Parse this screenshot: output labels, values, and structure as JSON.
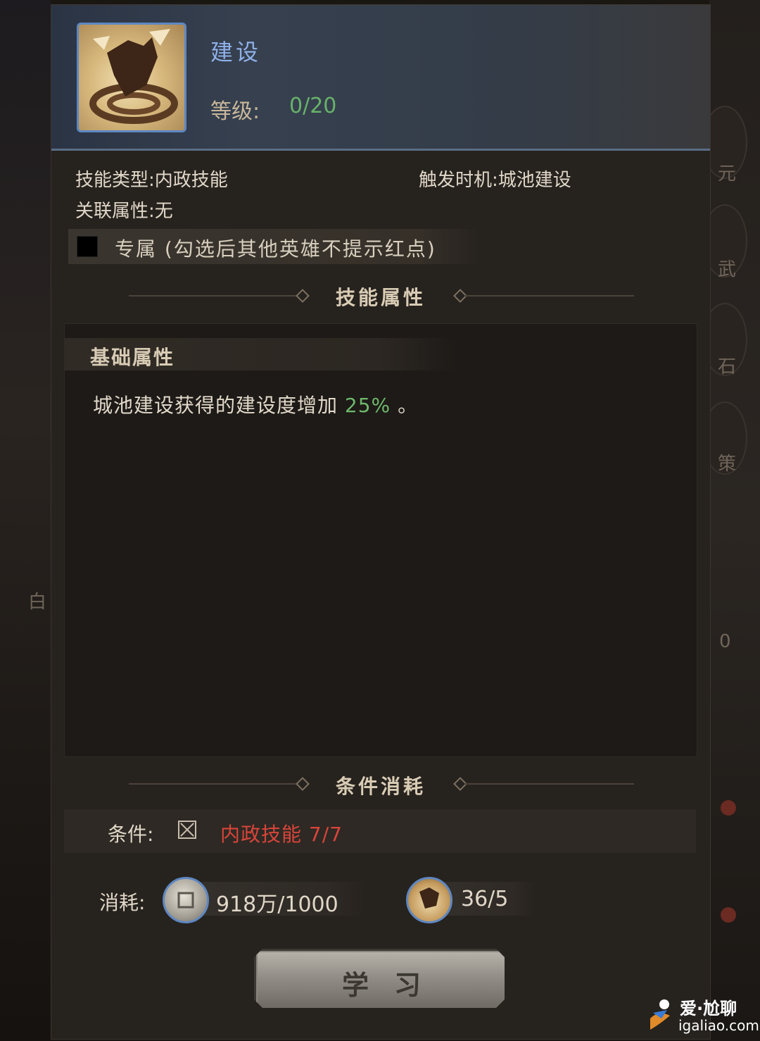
{
  "skill": {
    "name": "建设",
    "level_label": "等级:",
    "level_value": "0/20"
  },
  "info": {
    "type_label": "技能类型:",
    "type_value": "内政技能",
    "trigger_label": "触发时机:",
    "trigger_value": "城池建设",
    "attr_label": "关联属性:",
    "attr_value": "无"
  },
  "exclusive": {
    "label": "专属 (勾选后其他英雄不提示红点)",
    "checked": false
  },
  "sections": {
    "skill_attributes": "技能属性",
    "conditions_cost": "条件消耗"
  },
  "basic_attr": {
    "title": "基础属性",
    "desc_prefix": "城池建设获得的建设度增加",
    "desc_highlight": "25%",
    "desc_suffix": "。"
  },
  "condition": {
    "label": "条件:",
    "value": "内政技能 7/7",
    "color": "#d8453a"
  },
  "cost": {
    "label": "消耗:",
    "items": [
      {
        "icon": "silver-coin-icon",
        "value": "918万/1000"
      },
      {
        "icon": "skill-book-icon",
        "value": "36/5"
      }
    ]
  },
  "learn_button": "学习",
  "watermark": {
    "top": "爱·尬聊",
    "bottom": "igaliao.com"
  },
  "side_fragments": [
    "元",
    "武",
    "石",
    "策",
    "白",
    "0"
  ],
  "colors": {
    "accent_blue": "#5e87c2",
    "green": "#67b26a",
    "red": "#d8453a"
  }
}
